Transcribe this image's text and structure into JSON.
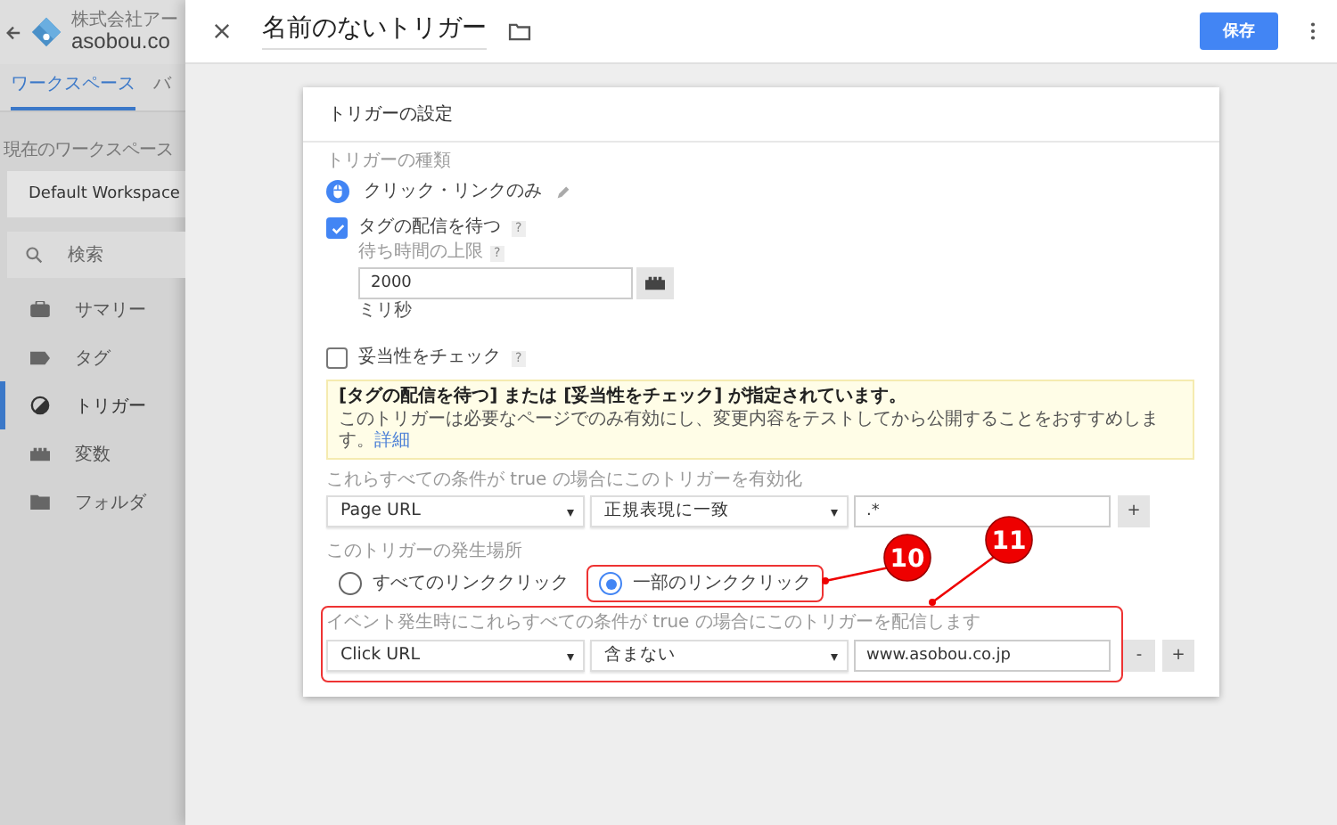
{
  "app": {
    "company": "株式会社アー",
    "account": "asobou.co",
    "tabs": [
      {
        "label": "ワークスペース",
        "selected": true
      },
      {
        "label": "バ",
        "selected": false
      }
    ],
    "workspace_label": "現在のワークスペース",
    "workspace": "Default Workspace",
    "search": {
      "placeholder": "検索"
    },
    "nav": [
      {
        "label": "サマリー",
        "kind": "briefcase",
        "selected": false
      },
      {
        "label": "タグ",
        "kind": "tag",
        "selected": false
      },
      {
        "label": "トリガー",
        "kind": "trigger",
        "selected": true
      },
      {
        "label": "変数",
        "kind": "block",
        "selected": false
      },
      {
        "label": "フォルダ",
        "kind": "folder",
        "selected": false
      }
    ]
  },
  "panel": {
    "title": "名前のないトリガー",
    "save": "保存",
    "card_title": "トリガーの設定",
    "type_label": "トリガーの種類",
    "type": "クリック・リンクのみ",
    "wait_tags": {
      "label": "タグの配信を待つ",
      "help": "?",
      "checked": true
    },
    "max_wait": {
      "label": "待ち時間の上限",
      "help": "?",
      "value": "2000",
      "unit": "ミリ秒"
    },
    "check_validation": {
      "label": "妥当性をチェック",
      "help": "?",
      "checked": false
    },
    "notice": {
      "title": "[タグの配信を待つ] または [妥当性をチェック] が指定されています。",
      "text": "このトリガーは必要なページでのみ有効にし、変更内容をテストしてから公開することをおすすめします。",
      "link": "詳細"
    },
    "enable_label": "これらすべての条件が true の場合にこのトリガーを有効化",
    "enable_conditions": [
      {
        "variable": "Page URL",
        "operator": "正規表現に一致",
        "value": ".*",
        "buttons": [
          "+"
        ]
      }
    ],
    "fire_on_label": "このトリガーの発生場所",
    "fire_on": [
      {
        "label": "すべてのリンククリック",
        "selected": false
      },
      {
        "label": "一部のリンククリック",
        "selected": true,
        "annotation": "10"
      }
    ],
    "event_label": "イベント発生時にこれらすべての条件が true の場合にこのトリガーを配信します",
    "event_annotation": "11",
    "event_conditions": [
      {
        "variable": "Click URL",
        "operator": "含まない",
        "value": "www.asobou.co.jp",
        "buttons": [
          "-",
          "+"
        ]
      }
    ]
  }
}
